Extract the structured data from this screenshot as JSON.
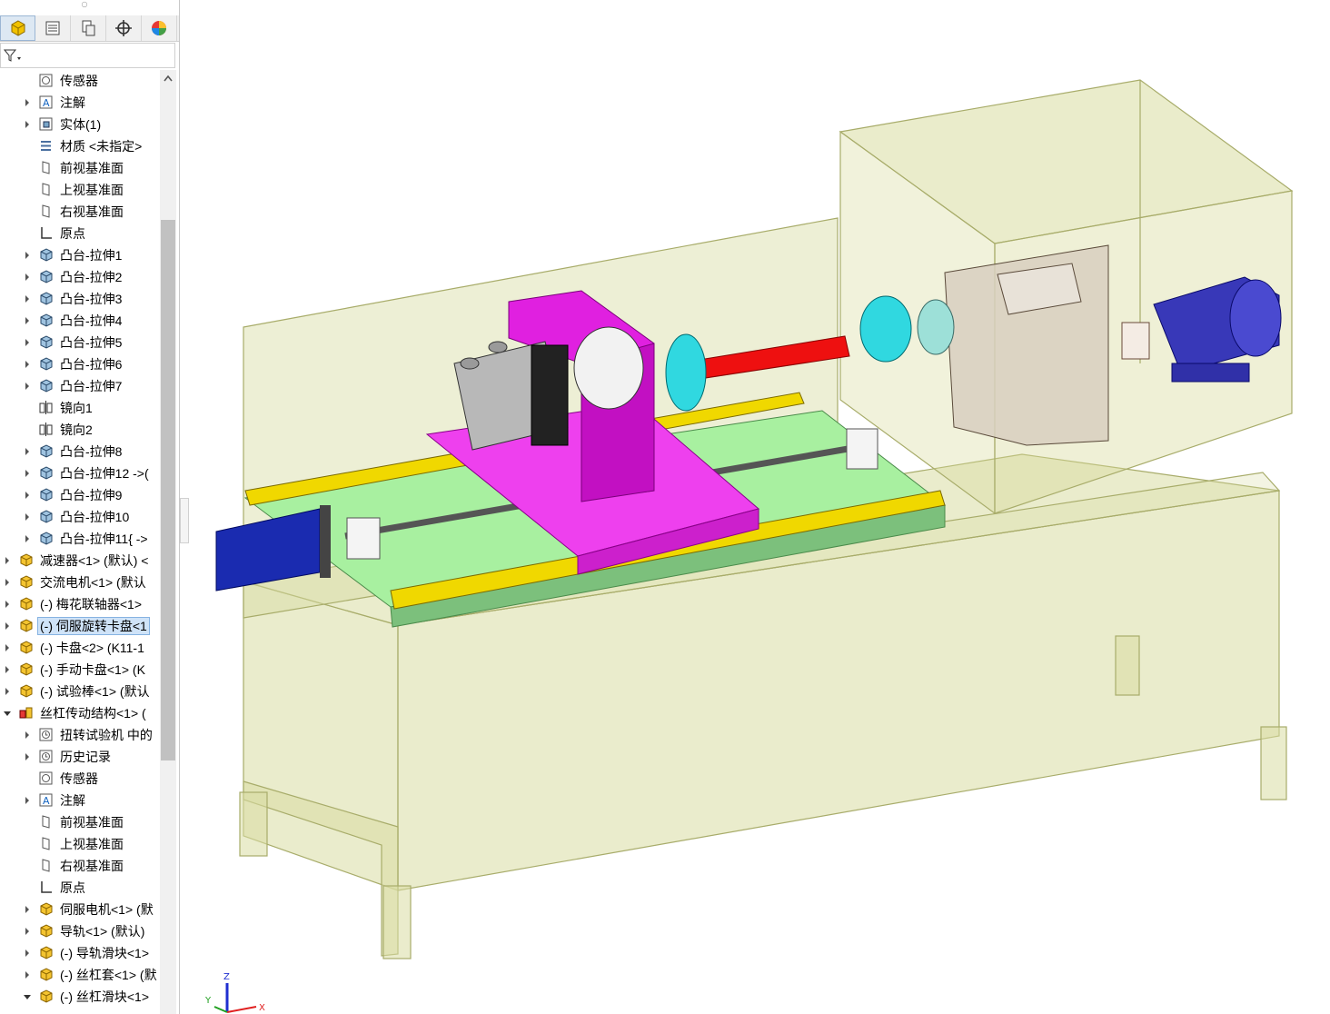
{
  "tabs": [
    {
      "name": "feature-manager",
      "icon": "part-cube-icon"
    },
    {
      "name": "property-manager",
      "icon": "property-list-icon"
    },
    {
      "name": "configuration-manager",
      "icon": "configuration-icon"
    },
    {
      "name": "dimxpert-manager",
      "icon": "crosshair-icon"
    },
    {
      "name": "display-manager",
      "icon": "color-wheel-icon"
    }
  ],
  "tree": {
    "items": [
      {
        "label": "传感器",
        "icon": "sensor-icon",
        "arrow": false
      },
      {
        "label": "注解",
        "icon": "annotation-icon",
        "arrow": true
      },
      {
        "label": "实体(1)",
        "icon": "solid-body-icon",
        "arrow": true
      },
      {
        "label": "材质 <未指定>",
        "icon": "material-icon",
        "arrow": false
      },
      {
        "label": "前视基准面",
        "icon": "plane-icon",
        "arrow": false
      },
      {
        "label": "上视基准面",
        "icon": "plane-icon",
        "arrow": false
      },
      {
        "label": "右视基准面",
        "icon": "plane-icon",
        "arrow": false
      },
      {
        "label": "原点",
        "icon": "origin-icon",
        "arrow": false
      },
      {
        "label": "凸台-拉伸1",
        "icon": "extrude-icon",
        "arrow": true
      },
      {
        "label": "凸台-拉伸2",
        "icon": "extrude-icon",
        "arrow": true
      },
      {
        "label": "凸台-拉伸3",
        "icon": "extrude-icon",
        "arrow": true
      },
      {
        "label": "凸台-拉伸4",
        "icon": "extrude-icon",
        "arrow": true
      },
      {
        "label": "凸台-拉伸5",
        "icon": "extrude-icon",
        "arrow": true
      },
      {
        "label": "凸台-拉伸6",
        "icon": "extrude-icon",
        "arrow": true
      },
      {
        "label": "凸台-拉伸7",
        "icon": "extrude-icon",
        "arrow": true
      },
      {
        "label": "镜向1",
        "icon": "mirror-icon",
        "arrow": false
      },
      {
        "label": "镜向2",
        "icon": "mirror-icon",
        "arrow": false
      },
      {
        "label": "凸台-拉伸8",
        "icon": "extrude-icon",
        "arrow": true
      },
      {
        "label": "凸台-拉伸12 ->(",
        "icon": "extrude-icon",
        "arrow": true
      },
      {
        "label": "凸台-拉伸9",
        "icon": "extrude-icon",
        "arrow": true
      },
      {
        "label": "凸台-拉伸10",
        "icon": "extrude-icon",
        "arrow": true
      },
      {
        "label": "凸台-拉伸11{ ->",
        "icon": "extrude-icon",
        "arrow": true
      },
      {
        "label": "减速器<1> (默认) <",
        "icon": "assembly-part-icon",
        "arrow": true
      },
      {
        "label": "交流电机<1> (默认",
        "icon": "assembly-part-icon",
        "arrow": true
      },
      {
        "label": "(-) 梅花联轴器<1>",
        "icon": "assembly-part-icon",
        "arrow": true
      },
      {
        "label": "(-) 伺服旋转卡盘<1",
        "icon": "assembly-part-icon",
        "arrow": true
      },
      {
        "label": "(-) 卡盘<2> (K11-1",
        "icon": "assembly-part-icon",
        "arrow": true
      },
      {
        "label": "(-) 手动卡盘<1> (K",
        "icon": "assembly-part-icon",
        "arrow": true
      },
      {
        "label": "(-) 试验棒<1> (默认",
        "icon": "assembly-part-icon",
        "arrow": true
      },
      {
        "label": "丝杠传动结构<1> (",
        "icon": "subassembly-icon",
        "arrow": true
      },
      {
        "label": "扭转试验机 中的",
        "icon": "history-icon",
        "arrow": true
      },
      {
        "label": "历史记录",
        "icon": "history-icon",
        "arrow": true
      },
      {
        "label": "传感器",
        "icon": "sensor-icon",
        "arrow": false
      },
      {
        "label": "注解",
        "icon": "annotation-icon",
        "arrow": true
      },
      {
        "label": "前视基准面",
        "icon": "plane-icon",
        "arrow": false
      },
      {
        "label": "上视基准面",
        "icon": "plane-icon",
        "arrow": false
      },
      {
        "label": "右视基准面",
        "icon": "plane-icon",
        "arrow": false
      },
      {
        "label": "原点",
        "icon": "origin-icon",
        "arrow": false
      },
      {
        "label": "伺服电机<1> (默",
        "icon": "assembly-part-icon",
        "arrow": true
      },
      {
        "label": "导轨<1> (默认)",
        "icon": "assembly-part-icon",
        "arrow": true
      },
      {
        "label": "(-) 导轨滑块<1>",
        "icon": "assembly-part-icon",
        "arrow": true
      },
      {
        "label": "(-) 丝杠套<1> (默",
        "icon": "assembly-part-icon",
        "arrow": true
      },
      {
        "label": "(-) 丝杠滑块<1>",
        "icon": "assembly-part-icon",
        "arrow": true
      }
    ]
  },
  "triad": {
    "x": "X",
    "y": "Y",
    "z": "Z"
  }
}
